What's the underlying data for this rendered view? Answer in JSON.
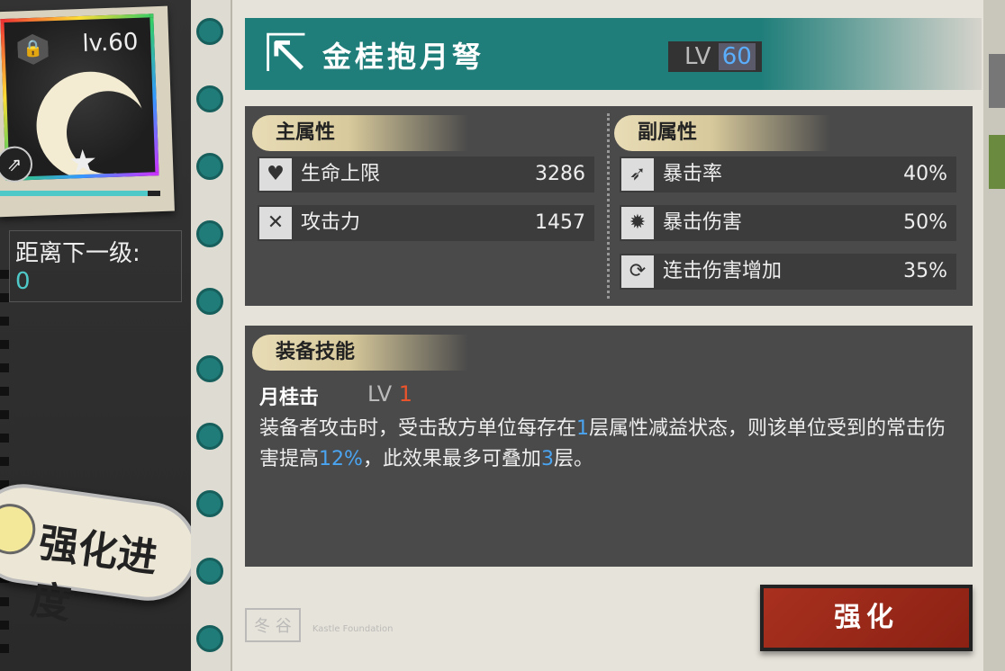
{
  "item": {
    "level": "lv.60",
    "icon": "crossbow-icon",
    "xp_fill": 0.92,
    "next_level_label": "距离下一级:",
    "next_level_value": "0"
  },
  "progress_button": {
    "label": "强化进度"
  },
  "title": {
    "name": "金桂抱月弩",
    "lv_prefix": "LV",
    "lv_value": "60"
  },
  "main_attr": {
    "title": "主属性",
    "rows": [
      {
        "label": "生命上限",
        "value": "3286",
        "icon": "heart-icon"
      },
      {
        "label": "攻击力",
        "value": "1457",
        "icon": "crossed-swords-icon"
      }
    ]
  },
  "sub_attr": {
    "title": "副属性",
    "rows": [
      {
        "label": "暴击率",
        "value": "40%",
        "icon": "crit-rate-icon"
      },
      {
        "label": "暴击伤害",
        "value": "50%",
        "icon": "crit-damage-icon"
      },
      {
        "label": "连击伤害增加",
        "value": "35%",
        "icon": "combo-icon"
      }
    ]
  },
  "skill": {
    "title": "装备技能",
    "name": "月桂击",
    "lv_prefix": "LV",
    "lv_value": "1",
    "desc": {
      "p1": "装备者攻击时，受击敌方单位每存在",
      "n1": "1",
      "p2": "层属性减益状态，则该单位受到的常击伤害提高",
      "n2": "12%",
      "p3": "，此效果最多可叠加",
      "n3": "3",
      "p4": "层。"
    }
  },
  "footer": {
    "stamp1": "冬 谷",
    "stamp2": "Kastle Foundation"
  },
  "enhance_button": {
    "label": "强化"
  },
  "colors": {
    "teal": "#1f7e7a",
    "accent_blue": "#4aa4f0",
    "enhance_red": "#a8301f",
    "lv_red": "#e8542c"
  }
}
